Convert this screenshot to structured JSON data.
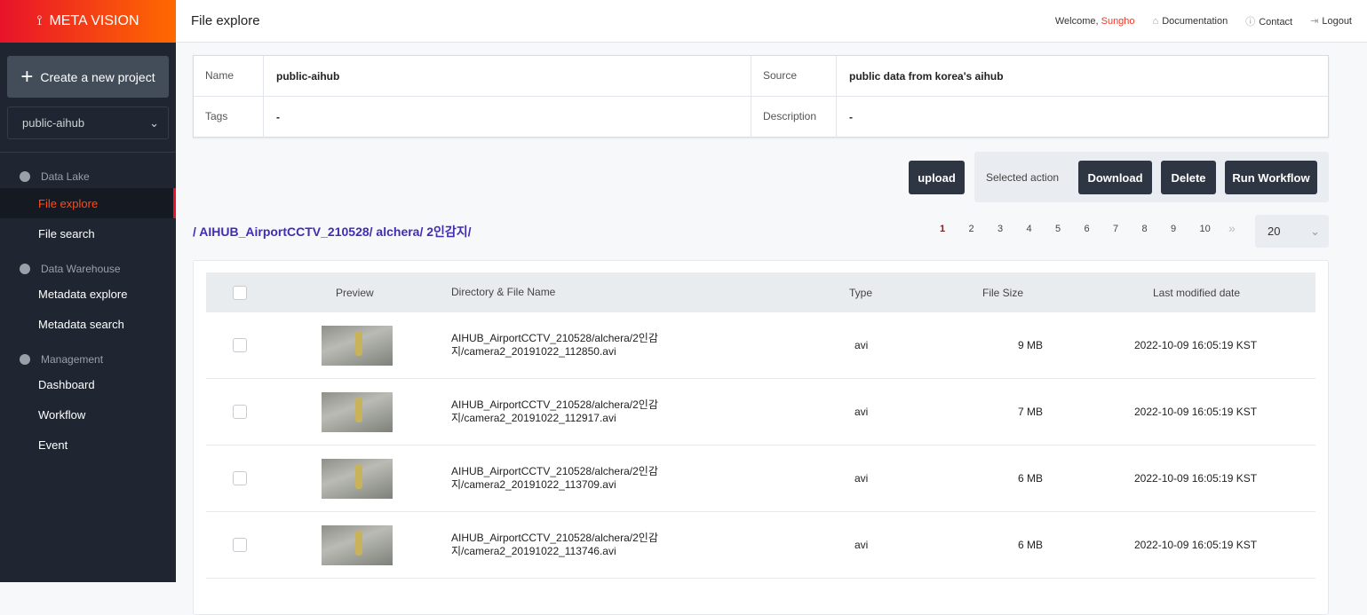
{
  "brand": "META VISION",
  "sidebar": {
    "create_label": "Create a new project",
    "project": "public-aihub",
    "sections": [
      {
        "label": "Data Lake",
        "items": [
          "File explore",
          "File search"
        ]
      },
      {
        "label": "Data Warehouse",
        "items": [
          "Metadata explore",
          "Metadata search"
        ]
      },
      {
        "label": "Management",
        "items": [
          "Dashboard",
          "Workflow",
          "Event"
        ]
      }
    ],
    "active": "File explore"
  },
  "header": {
    "title": "File explore",
    "welcome": "Welcome,",
    "user": "Sungho",
    "documentation": "Documentation",
    "contact": "Contact",
    "logout": "Logout"
  },
  "info": {
    "name_label": "Name",
    "name": "public-aihub",
    "source_label": "Source",
    "source": "public data from korea's aihub",
    "tags_label": "Tags",
    "tags": "-",
    "desc_label": "Description",
    "desc": "-"
  },
  "actions": {
    "upload": "upload",
    "selected_action": "Selected action",
    "download": "Download",
    "delete": "Delete",
    "run_workflow": "Run Workflow"
  },
  "breadcrumb": "/ AIHUB_AirportCCTV_210528/ alchera/ 2인감지/",
  "pagination": {
    "pages": [
      "1",
      "2",
      "3",
      "4",
      "5",
      "6",
      "7",
      "8",
      "9",
      "10"
    ],
    "current": "1",
    "page_size": "20"
  },
  "table": {
    "columns": [
      "Preview",
      "Directory & File Name",
      "Type",
      "File Size",
      "Last modified date"
    ],
    "rows": [
      {
        "name": "AIHUB_AirportCCTV_210528/alchera/2인감지/camera2_20191022_112850.avi",
        "type": "avi",
        "size": "9 MB",
        "date": "2022-10-09 16:05:19 KST"
      },
      {
        "name": "AIHUB_AirportCCTV_210528/alchera/2인감지/camera2_20191022_112917.avi",
        "type": "avi",
        "size": "7 MB",
        "date": "2022-10-09 16:05:19 KST"
      },
      {
        "name": "AIHUB_AirportCCTV_210528/alchera/2인감지/camera2_20191022_113709.avi",
        "type": "avi",
        "size": "6 MB",
        "date": "2022-10-09 16:05:19 KST"
      },
      {
        "name": "AIHUB_AirportCCTV_210528/alchera/2인감지/camera2_20191022_113746.avi",
        "type": "avi",
        "size": "6 MB",
        "date": "2022-10-09 16:05:19 KST"
      }
    ]
  }
}
